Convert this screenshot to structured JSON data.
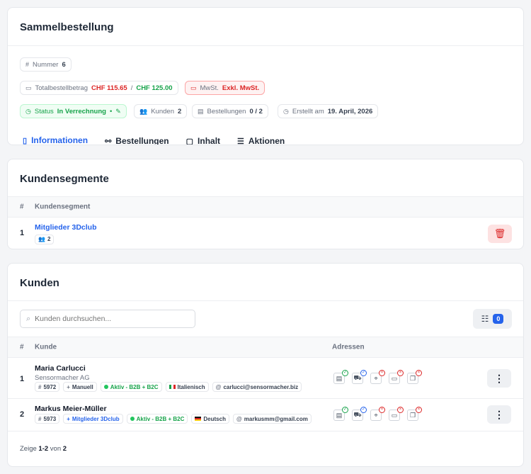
{
  "order": {
    "title": "Sammelbestellung",
    "number_label": "Nummer",
    "number": "6",
    "total_label": "Totalbestellbetrag",
    "total_value": "CHF 115.65",
    "total_sep": "/",
    "total_target": "CHF 125.00",
    "vat_label": "MwSt.",
    "vat_value": "Exkl. MwSt.",
    "status_label": "Status",
    "status_value": "In Verrechnung",
    "customers_label": "Kunden",
    "customers_value": "2",
    "orders_label": "Bestellungen",
    "orders_value": "0 / 2",
    "created_label": "Erstellt am",
    "created_value": "19. April, 2026",
    "tabs": [
      "Informationen",
      "Bestellungen",
      "Inhalt",
      "Aktionen"
    ],
    "active_tab": "Informationen"
  },
  "segments": {
    "title": "Kundensegmente",
    "col_num": "#",
    "col_segment": "Kundensegment",
    "rows": [
      {
        "num": "1",
        "name": "Mitglieder 3Dclub",
        "count": "2"
      }
    ]
  },
  "customers": {
    "title": "Kunden",
    "search_placeholder": "Kunden durchsuchen...",
    "filter_count": "0",
    "col_num": "#",
    "col_customer": "Kunde",
    "col_addresses": "Adressen",
    "rows": [
      {
        "num": "1",
        "name": "Maria Carlucci",
        "company": "Sensormacher AG",
        "id": "5972",
        "source": "Manuell",
        "status": "Aktiv - B2B + B2C",
        "language": "Italienisch",
        "email": "carlucci@sensormacher.biz"
      },
      {
        "num": "2",
        "name": "Markus Meier-Müller",
        "company": "",
        "id": "5973",
        "source": "Mitglieder 3Dclub",
        "status": "Aktiv - B2B + B2C",
        "language": "Deutsch",
        "email": "markusmm@gmail.com"
      }
    ],
    "pagination_prefix": "Zeige",
    "pagination_range": "1-2",
    "pagination_mid": "von",
    "pagination_total": "2"
  },
  "colors": {
    "accent": "#2563eb",
    "danger": "#dc2626",
    "success": "#16a34a"
  }
}
